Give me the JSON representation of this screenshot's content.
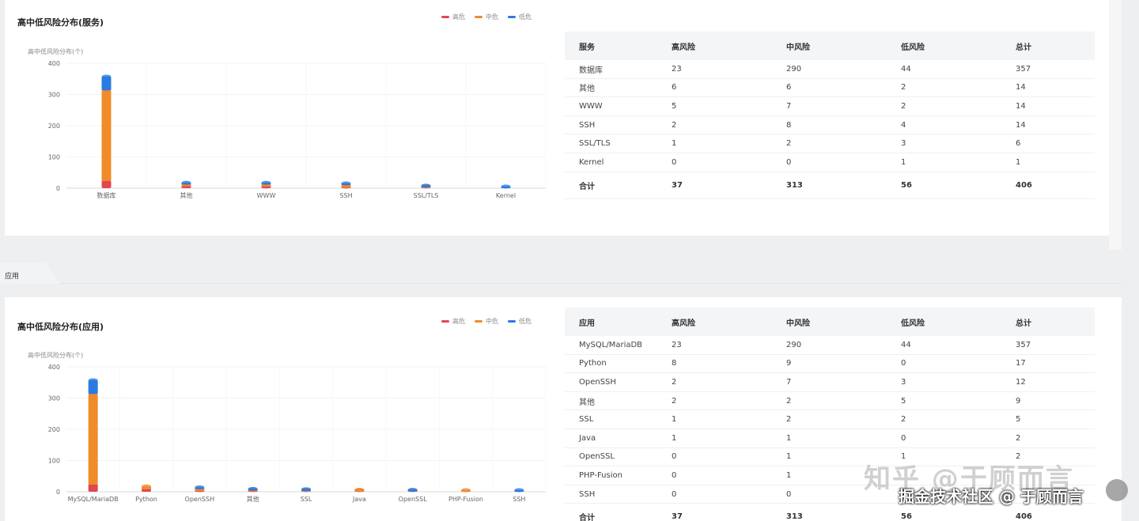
{
  "colors": {
    "high": "#e2474f",
    "mid": "#f08b2a",
    "low": "#2a7be0",
    "text_muted": "#888888",
    "panel_bg": "#ffffff"
  },
  "service_panel": {
    "title": "高中低风险分布(服务)",
    "legend": [
      "高危",
      "中危",
      "低危"
    ],
    "table": {
      "headers": [
        "服务",
        "高风险",
        "中风险",
        "低风险",
        "总计"
      ],
      "rows": [
        [
          "数据库",
          "23",
          "290",
          "44",
          "357"
        ],
        [
          "其他",
          "6",
          "6",
          "2",
          "14"
        ],
        [
          "WWW",
          "5",
          "7",
          "2",
          "14"
        ],
        [
          "SSH",
          "2",
          "8",
          "4",
          "14"
        ],
        [
          "SSL/TLS",
          "1",
          "2",
          "3",
          "6"
        ],
        [
          "Kernel",
          "0",
          "0",
          "1",
          "1"
        ]
      ],
      "total": [
        "合计",
        "37",
        "313",
        "56",
        "406"
      ]
    }
  },
  "section_tab": {
    "label": "应用"
  },
  "app_panel": {
    "title": "高中低风险分布(应用)",
    "legend": [
      "高危",
      "中危",
      "低危"
    ],
    "table": {
      "headers": [
        "应用",
        "高风险",
        "中风险",
        "低风险",
        "总计"
      ],
      "rows": [
        [
          "MySQL/MariaDB",
          "23",
          "290",
          "44",
          "357"
        ],
        [
          "Python",
          "8",
          "9",
          "0",
          "17"
        ],
        [
          "OpenSSH",
          "2",
          "7",
          "3",
          "12"
        ],
        [
          "其他",
          "2",
          "2",
          "5",
          "9"
        ],
        [
          "SSL",
          "1",
          "2",
          "2",
          "5"
        ],
        [
          "Java",
          "1",
          "1",
          "0",
          "2"
        ],
        [
          "OpenSSL",
          "0",
          "1",
          "1",
          "2"
        ],
        [
          "PHP-Fusion",
          "0",
          "1",
          "",
          ""
        ],
        [
          "SSH",
          "0",
          "0",
          "",
          ""
        ]
      ],
      "total": [
        "合计",
        "37",
        "313",
        "56",
        "406"
      ]
    }
  },
  "chart_data": [
    {
      "type": "bar",
      "stacked": true,
      "title": "高中低风险分布(服务)",
      "ylabel": "高中低风险分布(个)",
      "ylim": [
        0,
        400
      ],
      "yticks": [
        0,
        100,
        200,
        300,
        400
      ],
      "categories": [
        "数据库",
        "其他",
        "WWW",
        "SSH",
        "SSL/TLS",
        "Kernel"
      ],
      "series": [
        {
          "name": "高危",
          "values": [
            23,
            6,
            5,
            2,
            1,
            0
          ]
        },
        {
          "name": "中危",
          "values": [
            290,
            6,
            7,
            8,
            2,
            0
          ]
        },
        {
          "name": "低危",
          "values": [
            44,
            2,
            2,
            4,
            3,
            1
          ]
        }
      ],
      "legend_position": "top-right"
    },
    {
      "type": "bar",
      "stacked": true,
      "title": "高中低风险分布(应用)",
      "ylabel": "高中低风险分布(个)",
      "ylim": [
        0,
        400
      ],
      "yticks": [
        0,
        100,
        200,
        300,
        400
      ],
      "categories": [
        "MySQL/MariaDB",
        "Python",
        "OpenSSH",
        "其他",
        "SSL",
        "Java",
        "OpenSSL",
        "PHP-Fusion",
        "SSH"
      ],
      "series": [
        {
          "name": "高危",
          "values": [
            23,
            8,
            2,
            2,
            1,
            1,
            0,
            0,
            0
          ]
        },
        {
          "name": "中危",
          "values": [
            290,
            9,
            7,
            2,
            2,
            1,
            1,
            1,
            0
          ]
        },
        {
          "name": "低危",
          "values": [
            44,
            0,
            3,
            5,
            2,
            0,
            1,
            0,
            1
          ]
        }
      ],
      "legend_position": "top-right"
    }
  ],
  "watermarks": {
    "zhihu": "知乎 @于顾而言",
    "juejin": "掘金技术社区 @ 于顾而言"
  }
}
